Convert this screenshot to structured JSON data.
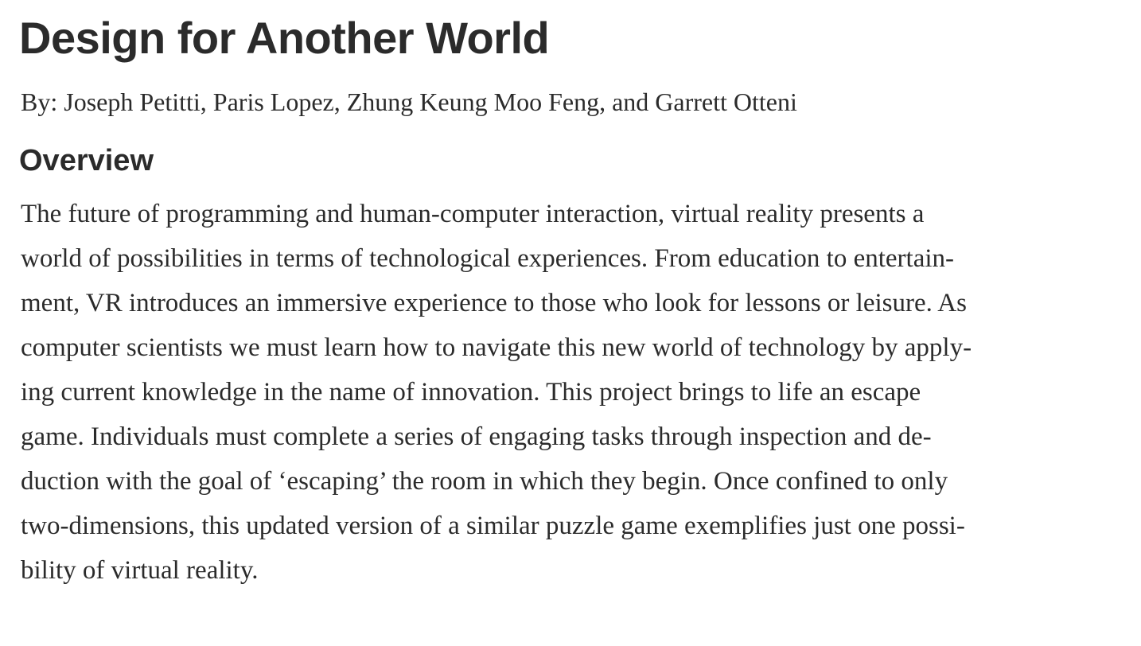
{
  "document": {
    "title": "Design for Another World",
    "authors": "By: Joseph Petitti, Paris Lopez, Zhung Keung Moo Feng, and Garrett Otteni",
    "sections": [
      {
        "heading": "Overview",
        "lines": [
          "The future of programming and human-computer interaction, virtual reality presents a",
          "world of possibilities in terms of technological experiences. From education to entertain-",
          "ment, VR introduces an immersive experience to those who look for lessons or leisure. As",
          "computer scientists we must learn how to navigate this new world of technology by apply-",
          "ing current knowledge in the name of innovation. This project brings to life an escape",
          "game. Individuals must complete a series of engaging tasks through inspection and de-",
          "duction with the goal of ‘escaping’ the room in which they begin. Once confined to only",
          "two-dimensions, this updated version of a similar puzzle game exemplifies just one possi-",
          "bility of virtual reality."
        ]
      }
    ]
  }
}
